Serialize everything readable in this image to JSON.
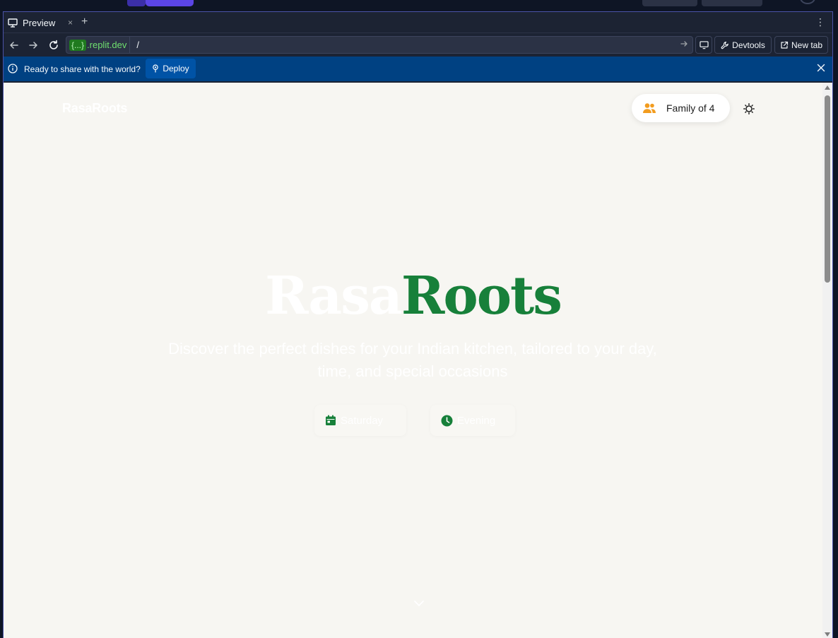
{
  "tabbar": {
    "tab_label": "Preview",
    "close_glyph": "×",
    "add_glyph": "+",
    "menu_glyph": "⋮"
  },
  "urlbar": {
    "host_badge": "{...}",
    "host_domain": ".replit.dev",
    "path": "/",
    "devtools_label": "Devtools",
    "newtab_label": "New tab"
  },
  "deploybar": {
    "message": "Ready to share with the world?",
    "deploy_label": "Deploy"
  },
  "app": {
    "brand": "RasaRoots",
    "family_label": "Family of 4",
    "hero_title_part1": "Rasa",
    "hero_title_part2": "Roots",
    "hero_subtitle": "Discover the perfect dishes for your Indian kitchen, tailored to your day, time, and special occasions",
    "day_label": "Saturday",
    "time_label": "Evening"
  },
  "colors": {
    "accent_green": "#17803a",
    "brand_orange": "#f29c1f",
    "deploy_blue": "#004182",
    "page_bg": "#f7f6f2"
  },
  "icons": [
    "monitor-icon",
    "back-arrow-icon",
    "forward-arrow-icon",
    "reload-icon",
    "wrench-icon",
    "external-link-icon",
    "info-icon",
    "pin-icon",
    "close-icon",
    "users-icon",
    "sun-icon",
    "calendar-icon",
    "clock-icon",
    "chevron-down-icon"
  ]
}
